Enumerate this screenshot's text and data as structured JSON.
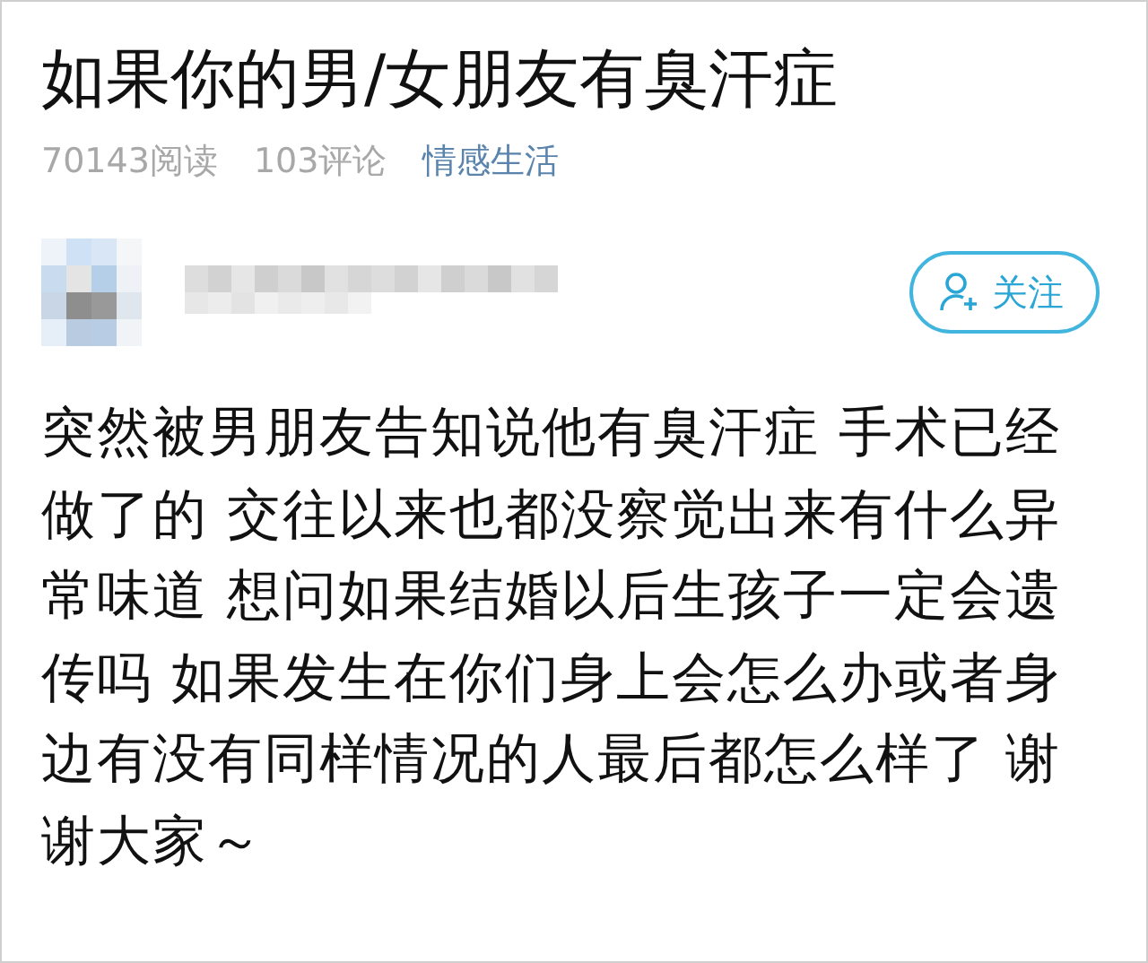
{
  "title": "如果你的男/女朋友有臭汗症",
  "meta": {
    "views": "70143阅读",
    "comments": "103评论",
    "category": "情感生活"
  },
  "author": {
    "follow_button": "关注"
  },
  "body": "突然被男朋友告知说他有臭汗症 手术已经做了的 交往以来也都没察觉出来有什么异常味道 想问如果结婚以后生孩子一定会遗传吗 如果发生在你们身上会怎么办或者身边有没有同样情况的人最后都怎么样了 谢谢大家～"
}
